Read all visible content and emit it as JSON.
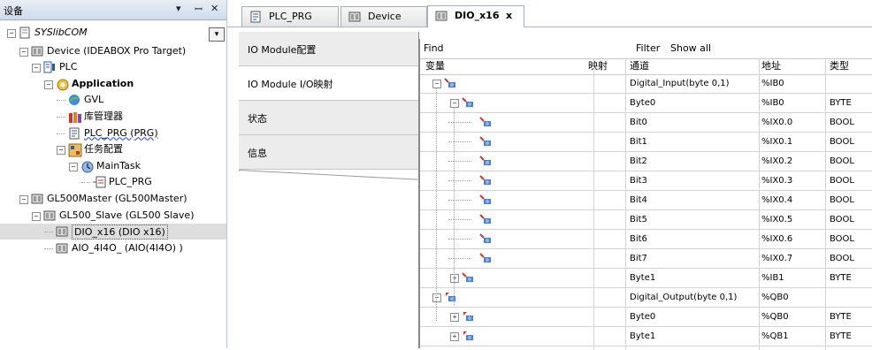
{
  "left_panel": {
    "title": "设备",
    "pin_icon": "pin-icon",
    "close_icon": "close-icon",
    "tree": [
      {
        "label": "SYSlibCOM",
        "indent": 0,
        "icon": "project-icon",
        "expander": "-"
      },
      {
        "label": "Device (IDEABOX Pro Target)",
        "indent": 1,
        "icon": "device-icon",
        "expander": "-"
      },
      {
        "label": "PLC",
        "indent": 2,
        "icon": "plc-icon",
        "expander": "-"
      },
      {
        "label": "Application",
        "indent": 3,
        "icon": "application-icon",
        "expander": "-"
      },
      {
        "label": "GVL",
        "indent": 4,
        "icon": "gvl-icon",
        "expander": ""
      },
      {
        "label": "库管理器",
        "indent": 4,
        "icon": "library-icon",
        "expander": ""
      },
      {
        "label": "PLC_PRG (PRG)",
        "indent": 4,
        "icon": "program-icon",
        "expander": ""
      },
      {
        "label": "任务配置",
        "indent": 4,
        "icon": "task-config-icon",
        "expander": "-"
      },
      {
        "label": "MainTask",
        "indent": 5,
        "icon": "task-icon",
        "expander": "-"
      },
      {
        "label": "PLC_PRG",
        "indent": 6,
        "icon": "program-call-icon",
        "expander": ""
      },
      {
        "label": "GL500Master (GL500Master)",
        "indent": 1,
        "icon": "device-icon",
        "expander": "-"
      },
      {
        "label": "GL500_Slave (GL500 Slave)",
        "indent": 2,
        "icon": "device-icon",
        "expander": "-"
      },
      {
        "label": "DIO_x16 (DIO x16)",
        "indent": 3,
        "icon": "device-icon",
        "expander": ""
      },
      {
        "label": "AIO_4I4O_ (AIO(4I4O) )",
        "indent": 3,
        "icon": "device-icon",
        "expander": ""
      }
    ]
  },
  "tabs": [
    {
      "label": "PLC_PRG",
      "icon": "program-icon"
    },
    {
      "label": "Device",
      "icon": "device-icon"
    },
    {
      "label": "DIO_x16",
      "icon": "device-icon",
      "close": "x"
    }
  ],
  "side_menu": [
    {
      "label": "IO Module配置"
    },
    {
      "label": "IO Module I/O映射"
    },
    {
      "label": "状态"
    },
    {
      "label": "信息"
    }
  ],
  "grid": {
    "find_label": "Find",
    "filter_label": "Filter",
    "filter_value": "Show all",
    "columns": [
      "变量",
      "映射",
      "通道",
      "地址",
      "类型"
    ],
    "rows": [
      {
        "channel": "Digital_Input(byte 0,1)",
        "address": "%IB0",
        "type": "",
        "level": 0,
        "expander": "-",
        "icon": "input-var-icon"
      },
      {
        "channel": "Byte0",
        "address": "%IB0",
        "type": "BYTE",
        "level": 1,
        "expander": "-",
        "icon": "input-var-icon"
      },
      {
        "channel": "Bit0",
        "address": "%IX0.0",
        "type": "BOOL",
        "level": 2,
        "expander": "",
        "icon": "input-var-icon"
      },
      {
        "channel": "Bit1",
        "address": "%IX0.1",
        "type": "BOOL",
        "level": 2,
        "expander": "",
        "icon": "input-var-icon"
      },
      {
        "channel": "Bit2",
        "address": "%IX0.2",
        "type": "BOOL",
        "level": 2,
        "expander": "",
        "icon": "input-var-icon"
      },
      {
        "channel": "Bit3",
        "address": "%IX0.3",
        "type": "BOOL",
        "level": 2,
        "expander": "",
        "icon": "input-var-icon"
      },
      {
        "channel": "Bit4",
        "address": "%IX0.4",
        "type": "BOOL",
        "level": 2,
        "expander": "",
        "icon": "input-var-icon"
      },
      {
        "channel": "Bit5",
        "address": "%IX0.5",
        "type": "BOOL",
        "level": 2,
        "expander": "",
        "icon": "input-var-icon"
      },
      {
        "channel": "Bit6",
        "address": "%IX0.6",
        "type": "BOOL",
        "level": 2,
        "expander": "",
        "icon": "input-var-icon"
      },
      {
        "channel": "Bit7",
        "address": "%IX0.7",
        "type": "BOOL",
        "level": 2,
        "expander": "",
        "icon": "input-var-icon"
      },
      {
        "channel": "Byte1",
        "address": "%IB1",
        "type": "BYTE",
        "level": 1,
        "expander": "+",
        "icon": "input-var-icon"
      },
      {
        "channel": "Digital_Output(byte 0,1)",
        "address": "%QB0",
        "type": "",
        "level": 0,
        "expander": "-",
        "icon": "output-var-icon"
      },
      {
        "channel": "Byte0",
        "address": "%QB0",
        "type": "BYTE",
        "level": 1,
        "expander": "+",
        "icon": "output-var-icon"
      },
      {
        "channel": "Byte1",
        "address": "%QB1",
        "type": "BYTE",
        "level": 1,
        "expander": "+",
        "icon": "output-var-icon"
      }
    ]
  }
}
